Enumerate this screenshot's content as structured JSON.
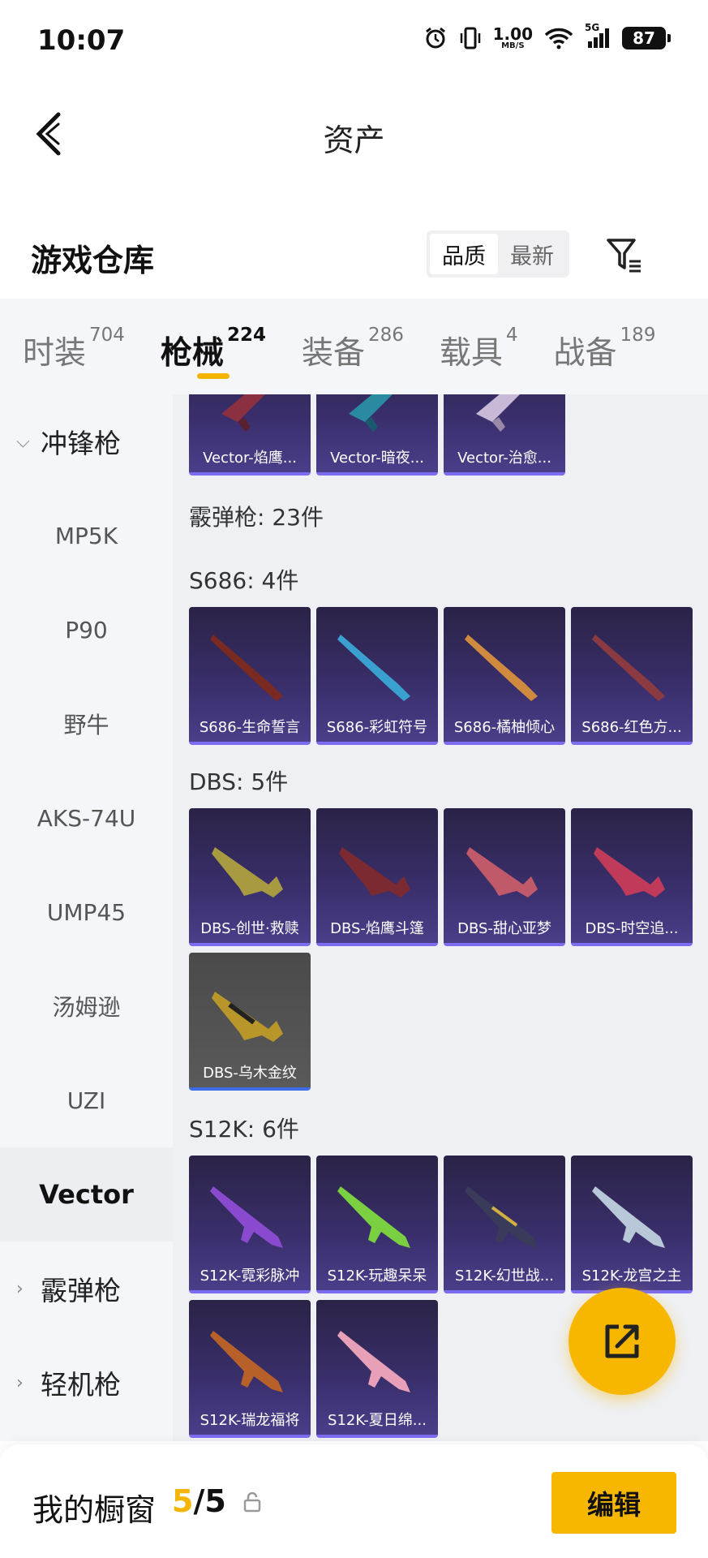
{
  "status_bar": {
    "time": "10:07",
    "net_speed_value": "1.00",
    "net_speed_unit": "MB/S",
    "network_label": "5G",
    "battery": "87"
  },
  "nav": {
    "title": "资产"
  },
  "section": {
    "title": "游戏仓库",
    "sort_options": [
      "品质",
      "最新"
    ],
    "sort_active": "品质"
  },
  "category_tabs": [
    {
      "label": "时装",
      "count": "704"
    },
    {
      "label": "枪械",
      "count": "224",
      "active": true
    },
    {
      "label": "装备",
      "count": "286"
    },
    {
      "label": "载具",
      "count": "4"
    },
    {
      "label": "战备",
      "count": "189"
    }
  ],
  "sidebar": {
    "items": [
      {
        "label": "冲锋枪",
        "type": "group",
        "chevron": "down"
      },
      {
        "label": "MP5K",
        "type": "sub"
      },
      {
        "label": "P90",
        "type": "sub"
      },
      {
        "label": "野牛",
        "type": "sub"
      },
      {
        "label": "AKS-74U",
        "type": "sub"
      },
      {
        "label": "UMP45",
        "type": "sub"
      },
      {
        "label": "汤姆逊",
        "type": "sub"
      },
      {
        "label": "UZI",
        "type": "sub"
      },
      {
        "label": "Vector",
        "type": "sub",
        "selected": true
      },
      {
        "label": "霰弹枪",
        "type": "group",
        "chevron": "right"
      },
      {
        "label": "轻机枪",
        "type": "group",
        "chevron": "right"
      }
    ]
  },
  "content": {
    "top_partial_items": [
      "Vector-焰鹰...",
      "Vector-暗夜...",
      "Vector-治愈..."
    ],
    "shotgun_header": "霰弹枪: 23件",
    "groups": [
      {
        "header": "S686: 4件",
        "items": [
          "S686-生命誓言",
          "S686-彩虹符号",
          "S686-橘柚倾心",
          "S686-红色方..."
        ]
      },
      {
        "header": "DBS: 5件",
        "items": [
          "DBS-创世·救赎",
          "DBS-焰鹰斗篷",
          "DBS-甜心亚梦",
          "DBS-时空追...",
          "DBS-乌木金纹"
        ]
      },
      {
        "header": "S12K: 6件",
        "items": [
          "S12K-霓彩脉冲",
          "S12K-玩趣呆呆",
          "S12K-幻世战...",
          "S12K-龙宫之主",
          "S12K-瑞龙福将",
          "S12K-夏日绵..."
        ]
      }
    ]
  },
  "bottom_bar": {
    "showcase_label": "我的橱窗",
    "current": "5",
    "separator": "/",
    "total": "5",
    "edit_label": "编辑"
  },
  "colors": {
    "accent": "#f7b600",
    "card_bg": "#3a2f6c",
    "card_border": "#7c6cf0"
  },
  "icons": [
    "back-icon",
    "filter-icon",
    "share-icon",
    "lock-icon",
    "alarm-icon",
    "vibrate-icon",
    "wifi-icon",
    "signal-icon"
  ]
}
